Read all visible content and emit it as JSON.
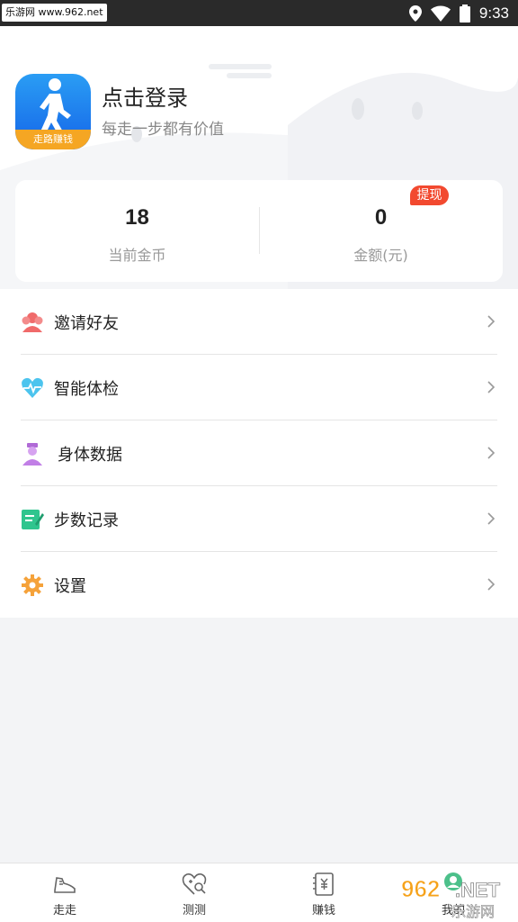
{
  "status_bar": {
    "watermark_text": "乐游网 www.962.net",
    "time": "9:33"
  },
  "profile": {
    "icon_name": "walking-person-app-icon",
    "icon_banner": "走路赚钱",
    "login_title": "点击登录",
    "subtitle": "每走一步都有价值"
  },
  "stats": {
    "coins_value": "18",
    "coins_label": "当前金币",
    "amount_value": "0",
    "amount_label": "金额(元)",
    "withdraw_label": "提现"
  },
  "menu": {
    "items": [
      {
        "label": "邀请好友",
        "icon": "invite-friends-icon"
      },
      {
        "label": "智能体检",
        "icon": "heart-pulse-icon"
      },
      {
        "label": "身体数据",
        "icon": "doctor-icon"
      },
      {
        "label": "步数记录",
        "icon": "notebook-icon"
      },
      {
        "label": "设置",
        "icon": "gear-icon"
      }
    ]
  },
  "bottom_nav": {
    "items": [
      {
        "label": "走走",
        "icon": "shoe-icon"
      },
      {
        "label": "测测",
        "icon": "heart-search-icon"
      },
      {
        "label": "赚钱",
        "icon": "money-book-icon"
      },
      {
        "label": "我的",
        "icon": "profile-icon"
      }
    ]
  },
  "watermark_bottom": "962.NET 乐游网",
  "colors": {
    "accent_red": "#f2492f",
    "app_icon_blue": "#1e88f0",
    "banner_orange": "#f5a623"
  }
}
